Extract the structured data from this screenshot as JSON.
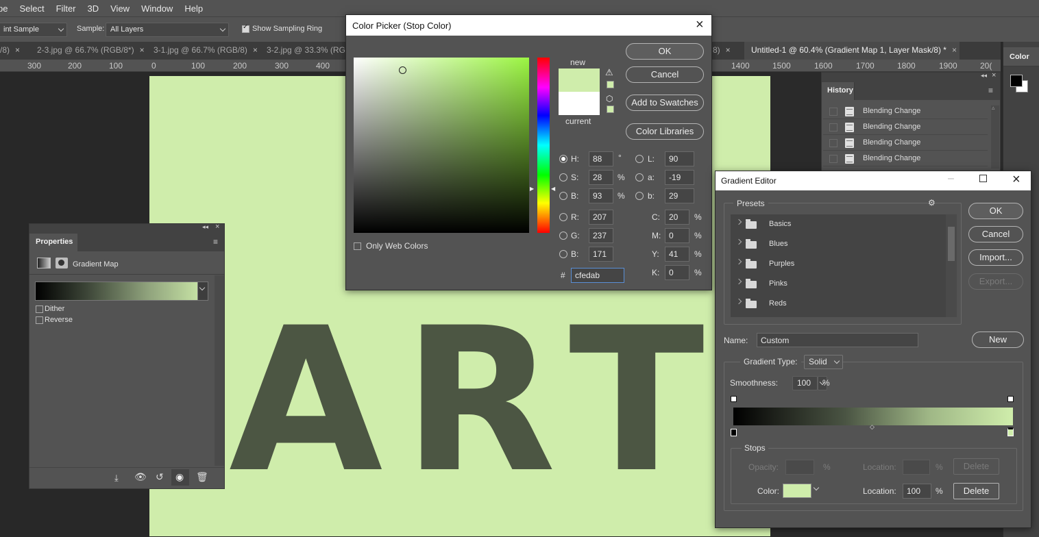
{
  "menu": [
    "pe",
    "Select",
    "Filter",
    "3D",
    "View",
    "Window",
    "Help"
  ],
  "options": {
    "sample_size": "int Sample",
    "sample_label": "Sample:",
    "sample_value": "All Layers",
    "show_ring_label": "Show Sampling Ring"
  },
  "tabs": [
    {
      "label": "/8)"
    },
    {
      "label": "2-3.jpg @ 66.7% (RGB/8*)"
    },
    {
      "label": "3-1.jpg @ 66.7% (RGB/8)"
    },
    {
      "label": "3-2.jpg @ 33.3% (RGB/"
    },
    {
      "label": "8)"
    },
    {
      "label": "Untitled-1 @ 60.4% (Gradient Map 1, Layer Mask/8) *"
    }
  ],
  "ruler": [
    "300",
    "200",
    "100",
    "0",
    "100",
    "200",
    "300",
    "400",
    "1400",
    "1500",
    "1600",
    "1700",
    "1800",
    "1900",
    "20("
  ],
  "canvas": {
    "letters": [
      "A",
      "R",
      "T"
    ],
    "bg_color": "#cfedab"
  },
  "history": {
    "title": "History",
    "items": [
      "Blending Change",
      "Blending Change",
      "Blending Change",
      "Blending Change"
    ]
  },
  "color_panel": {
    "title": "Color"
  },
  "properties": {
    "title": "Properties",
    "layer_type": "Gradient Map",
    "dither_label": "Dither",
    "reverse_label": "Reverse"
  },
  "color_picker": {
    "title": "Color Picker (Stop Color)",
    "ok": "OK",
    "cancel": "Cancel",
    "add_swatches": "Add to Swatches",
    "color_libraries": "Color Libraries",
    "new_label": "new",
    "current_label": "current",
    "new_color": "#cfedab",
    "current_color": "#ffffff",
    "only_web_colors": "Only Web Colors",
    "hsb": {
      "H": "88",
      "S": "28",
      "B": "93"
    },
    "rgb": {
      "R": "207",
      "G": "237",
      "B": "171"
    },
    "lab": {
      "L": "90",
      "a": "-19",
      "b": "29"
    },
    "cmyk": {
      "C": "20",
      "M": "0",
      "Y": "41",
      "K": "0"
    },
    "hex_label": "#",
    "hex": "cfedab",
    "labels": {
      "H": "H:",
      "S": "S:",
      "B": "B:",
      "R": "R:",
      "G": "G:",
      "B2": "B:",
      "L": "L:",
      "a": "a:",
      "b": "b:",
      "C": "C:",
      "M": "M:",
      "Y": "Y:",
      "K": "K:"
    },
    "units": {
      "deg": "°",
      "pct": "%"
    }
  },
  "gradient_editor": {
    "title": "Gradient Editor",
    "presets_label": "Presets",
    "presets": [
      "Basics",
      "Blues",
      "Purples",
      "Pinks",
      "Reds"
    ],
    "ok": "OK",
    "cancel": "Cancel",
    "import": "Import...",
    "export": "Export...",
    "name_label": "Name:",
    "name_value": "Custom",
    "new": "New",
    "gradient_type_label": "Gradient Type:",
    "gradient_type": "Solid",
    "smoothness_label": "Smoothness:",
    "smoothness": "100",
    "smoothness_unit": "%",
    "stops_label": "Stops",
    "opacity_label": "Opacity:",
    "opacity_unit": "%",
    "location_label": "Location:",
    "location_unit": "%",
    "delete": "Delete",
    "color_label": "Color:",
    "color_location": "100",
    "stop_color": "#cfedab"
  }
}
